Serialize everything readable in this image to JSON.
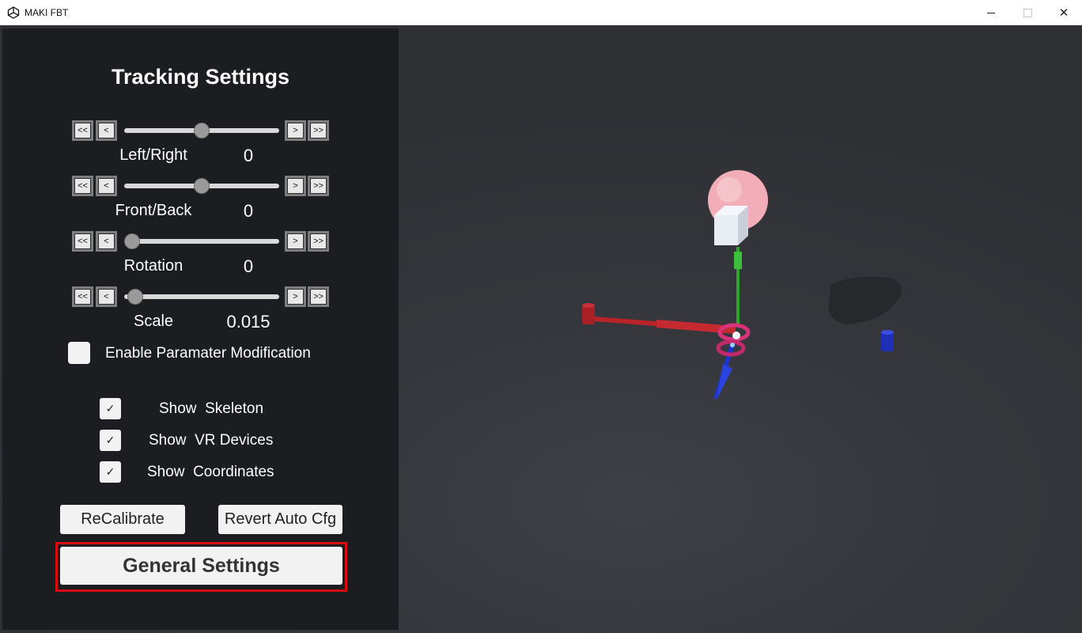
{
  "window": {
    "title": "MAKI FBT",
    "controls": {
      "minimize": "minimize",
      "maximize": "maximize",
      "close": "✕"
    }
  },
  "panel": {
    "title": "Tracking Settings",
    "sliders": [
      {
        "label": "Left/Right",
        "value": "0",
        "level": 0.5
      },
      {
        "label": "Front/Back",
        "value": "0",
        "level": 0.5
      },
      {
        "label": "Rotation",
        "value": "0",
        "level": 0.0
      },
      {
        "label": "Scale",
        "value": "0.015",
        "level": 0.02
      }
    ],
    "step_buttons": {
      "fast_back": "<<",
      "back": "<",
      "forward": ">",
      "fast_forward": ">>"
    },
    "enable_param": {
      "label": "Enable Paramater Modification",
      "checked": false
    },
    "options": [
      {
        "label": "Show  Skeleton",
        "checked": true
      },
      {
        "label": "Show  VR Devices",
        "checked": true
      },
      {
        "label": "Show  Coordinates",
        "checked": true
      }
    ],
    "check_glyph": "✓",
    "recalibrate_label": "ReCalibrate",
    "revert_label": "Revert Auto Cfg",
    "general_settings_label": "General Settings"
  },
  "colors": {
    "panel_bg": "#1c1d20",
    "viewport_bg": "#35373c",
    "highlight": "#d80b12",
    "axis_x": "#b8242a",
    "axis_y": "#2ea52e",
    "axis_z": "#1f35c8",
    "head": "#f2aeb8"
  }
}
